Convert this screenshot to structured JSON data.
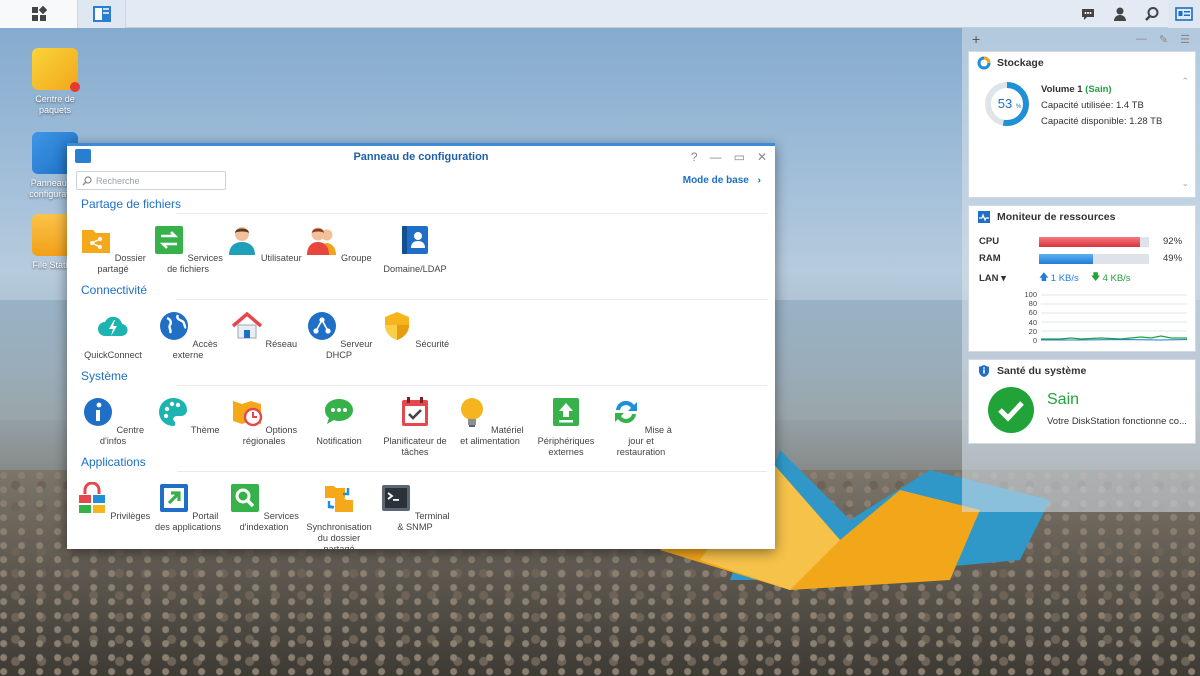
{
  "desktop": {
    "icons": [
      {
        "label": "Centre de paquets"
      },
      {
        "label": "Panneau de configuration"
      },
      {
        "label": "File Station"
      }
    ]
  },
  "window": {
    "title": "Panneau de configuration",
    "controls": {
      "help": "?",
      "minimize": "—",
      "maximize": "▭",
      "close": "✕"
    },
    "search_placeholder": "Recherche",
    "mode_link": "Mode de base",
    "sections": [
      {
        "title": "Partage de fichiers",
        "items": [
          "Dossier partagé",
          "Services de fichiers",
          "Utilisateur",
          "Groupe",
          "Domaine/LDAP"
        ]
      },
      {
        "title": "Connectivité",
        "items": [
          "QuickConnect",
          "Accès externe",
          "Réseau",
          "Serveur DHCP",
          "Sécurité"
        ]
      },
      {
        "title": "Système",
        "items": [
          "Centre d'infos",
          "Thème",
          "Options régionales",
          "Notification",
          "Planificateur de tâches",
          "Matériel et alimentation",
          "Périphériques externes",
          "Mise à jour et restauration"
        ]
      },
      {
        "title": "Applications",
        "items": [
          "Privilèges",
          "Portail des applications",
          "Services d'indexation",
          "Synchronisation du dossier partagé",
          "Terminal & SNMP"
        ]
      }
    ]
  },
  "widgets": {
    "storage": {
      "title": "Stockage",
      "percent": "53",
      "percent_unit": "%",
      "percent_value": 53,
      "volume_name": "Volume 1",
      "volume_status": "(Sain)",
      "used_label": "Capacité utilisée: 1.4 TB",
      "free_label": "Capacité disponible: 1.28 TB"
    },
    "resources": {
      "title": "Moniteur de ressources",
      "cpu_label": "CPU",
      "cpu_value": "92%",
      "cpu_percent": 92,
      "ram_label": "RAM",
      "ram_value": "49%",
      "ram_percent": 49,
      "lan_label": "LAN ▾",
      "lan_up": "1 KB/s",
      "lan_down": "4 KB/s",
      "y_ticks": [
        "100",
        "80",
        "60",
        "40",
        "20",
        "0"
      ]
    },
    "health": {
      "title": "Santé du système",
      "status": "Sain",
      "message": "Votre DiskStation fonctionne co..."
    }
  },
  "colors": {
    "accent": "#1d6fc4",
    "ok": "#22a33a",
    "cpu": "#e5474f",
    "ram": "#2e8de0"
  }
}
